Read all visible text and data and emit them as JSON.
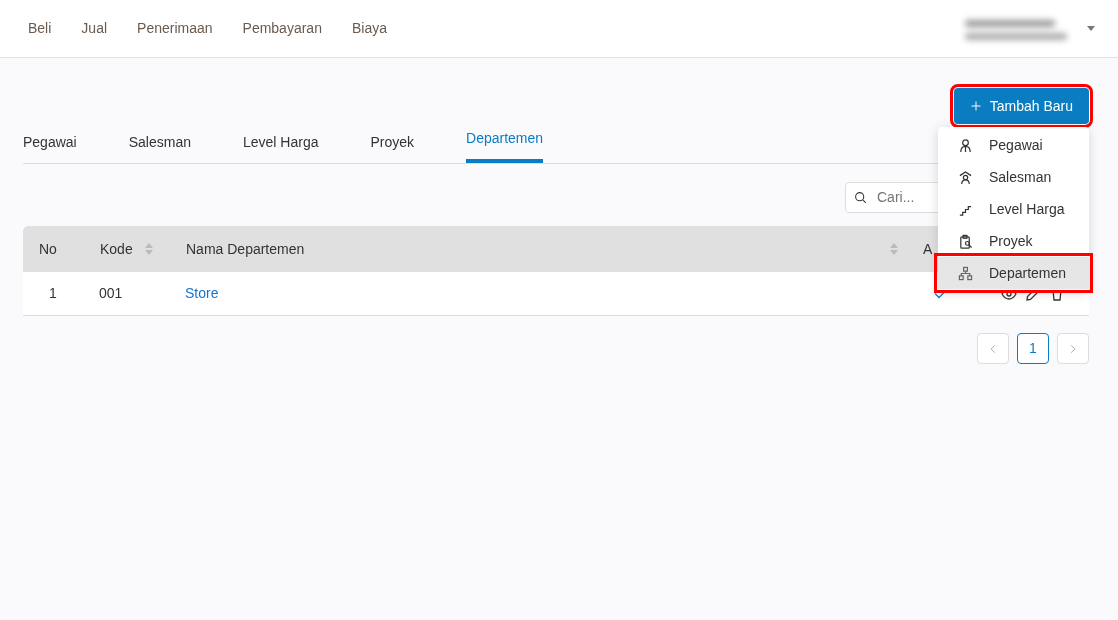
{
  "top_nav": [
    {
      "label": "Beli"
    },
    {
      "label": "Jual"
    },
    {
      "label": "Penerimaan"
    },
    {
      "label": "Pembayaran"
    },
    {
      "label": "Biaya"
    }
  ],
  "add_button": {
    "label": "Tambah Baru",
    "highlighted": true
  },
  "add_menu": [
    {
      "label": "Pegawai",
      "kind": "person",
      "selected": false,
      "highlighted": false
    },
    {
      "label": "Salesman",
      "kind": "salesman",
      "selected": false,
      "highlighted": false
    },
    {
      "label": "Level Harga",
      "kind": "stairs",
      "selected": false,
      "highlighted": false
    },
    {
      "label": "Proyek",
      "kind": "clipboard",
      "selected": false,
      "highlighted": false
    },
    {
      "label": "Departemen",
      "kind": "hierarchy",
      "selected": true,
      "highlighted": true
    }
  ],
  "tabs": [
    {
      "label": "Pegawai",
      "selected": false
    },
    {
      "label": "Salesman",
      "selected": false
    },
    {
      "label": "Level Harga",
      "selected": false
    },
    {
      "label": "Proyek",
      "selected": false
    },
    {
      "label": "Departemen",
      "selected": true
    }
  ],
  "search": {
    "placeholder": "Cari..."
  },
  "table": {
    "columns": [
      {
        "label": "No",
        "sortable": false
      },
      {
        "label": "Kode",
        "sortable": true
      },
      {
        "label": "Nama Departemen",
        "sortable": true
      },
      {
        "label": "A"
      }
    ],
    "rows": [
      {
        "no": "1",
        "kode": "001",
        "nama": "Store",
        "active": true
      }
    ]
  },
  "pagination": [
    {
      "label": "1",
      "selected": true
    }
  ]
}
